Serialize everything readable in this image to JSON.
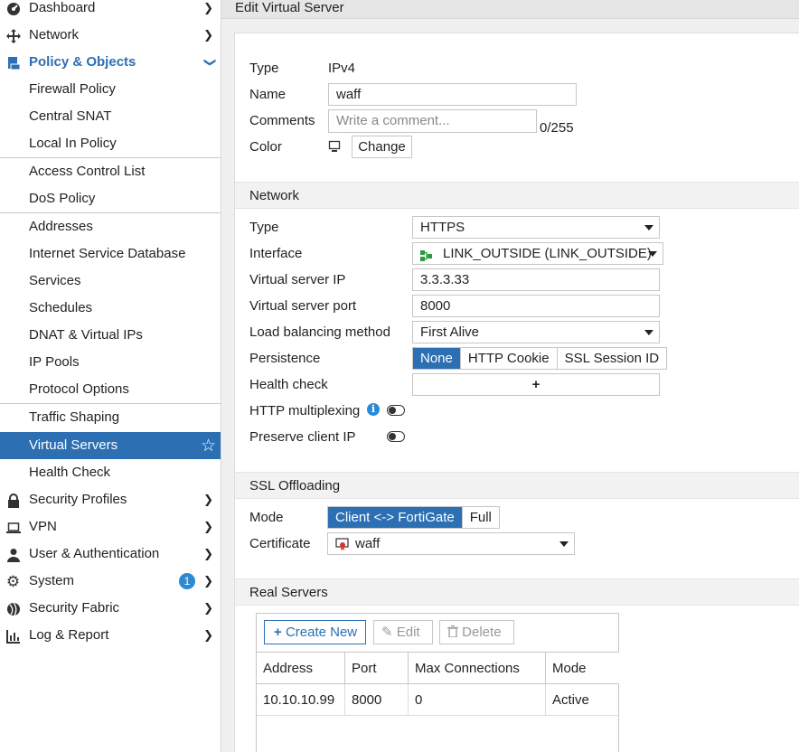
{
  "sidebar": {
    "items": [
      {
        "label": "Dashboard",
        "icon": "gauge-icon"
      },
      {
        "label": "Network",
        "icon": "network-arrows-icon"
      },
      {
        "label": "Policy & Objects",
        "icon": "policy-icon"
      },
      {
        "label": "Firewall Policy"
      },
      {
        "label": "Central SNAT"
      },
      {
        "label": "Local In Policy"
      },
      {
        "label": "Access Control List"
      },
      {
        "label": "DoS Policy"
      },
      {
        "label": "Addresses"
      },
      {
        "label": "Internet Service Database"
      },
      {
        "label": "Services"
      },
      {
        "label": "Schedules"
      },
      {
        "label": "DNAT & Virtual IPs"
      },
      {
        "label": "IP Pools"
      },
      {
        "label": "Protocol Options"
      },
      {
        "label": "Traffic Shaping"
      },
      {
        "label": "Virtual Servers"
      },
      {
        "label": "Health Check"
      },
      {
        "label": "Security Profiles",
        "icon": "lock-icon"
      },
      {
        "label": "VPN",
        "icon": "laptop-icon"
      },
      {
        "label": "User & Authentication",
        "icon": "user-icon"
      },
      {
        "label": "System",
        "icon": "gear-icon",
        "badge": "1"
      },
      {
        "label": "Security Fabric",
        "icon": "fabric-icon"
      },
      {
        "label": "Log & Report",
        "icon": "chart-icon"
      }
    ]
  },
  "header": {
    "title": "Edit Virtual Server"
  },
  "general": {
    "type_label": "Type",
    "type_value": "IPv4",
    "name_label": "Name",
    "name_value": "waff",
    "comments_label": "Comments",
    "comments_placeholder": "Write a comment...",
    "comments_count": "0/255",
    "color_label": "Color",
    "color_button": "Change"
  },
  "network": {
    "section_title": "Network",
    "type_label": "Type",
    "type_value": "HTTPS",
    "interface_label": "Interface",
    "interface_value": "LINK_OUTSIDE (LINK_OUTSIDE)",
    "vip_label": "Virtual server IP",
    "vip_value": "3.3.3.33",
    "vport_label": "Virtual server port",
    "vport_value": "8000",
    "lb_label": "Load balancing method",
    "lb_value": "First Alive",
    "persistence_label": "Persistence",
    "persistence_options": [
      "None",
      "HTTP Cookie",
      "SSL Session ID"
    ],
    "health_label": "Health check",
    "health_add": "+",
    "multiplexing_label": "HTTP multiplexing",
    "preserve_label": "Preserve client IP"
  },
  "ssl": {
    "section_title": "SSL Offloading",
    "mode_label": "Mode",
    "mode_options": [
      "Client <-> FortiGate",
      "Full"
    ],
    "cert_label": "Certificate",
    "cert_value": "waff"
  },
  "real_servers": {
    "section_title": "Real Servers",
    "create_label": "Create New",
    "edit_label": "Edit",
    "delete_label": "Delete",
    "columns": [
      "Address",
      "Port",
      "Max Connections",
      "Mode"
    ],
    "rows": [
      [
        "10.10.10.99",
        "8000",
        "0",
        "Active"
      ]
    ]
  },
  "colors": {
    "accent": "#2c6fb3",
    "info": "#2c8ad3"
  }
}
